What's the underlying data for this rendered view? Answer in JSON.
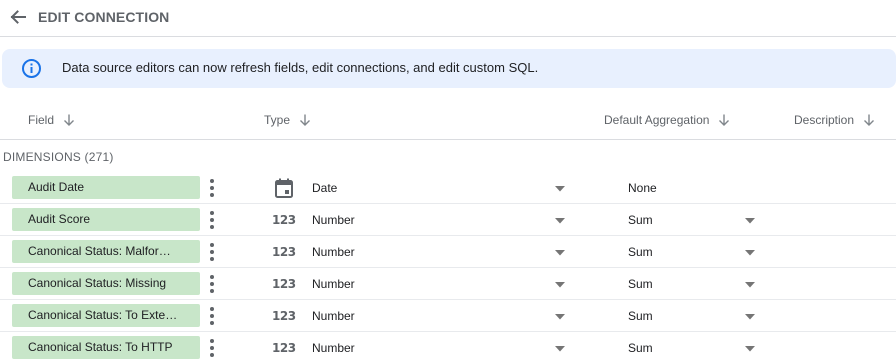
{
  "header": {
    "title": "EDIT CONNECTION"
  },
  "banner": {
    "text": "Data source editors can now refresh fields, edit connections, and edit custom SQL."
  },
  "columns": {
    "field": "Field",
    "type": "Type",
    "default_aggregation": "Default Aggregation",
    "description": "Description"
  },
  "dimensions": {
    "label": "DIMENSIONS (271)"
  },
  "rows": [
    {
      "field": "Audit Date",
      "type_icon": "calendar-icon",
      "type": "Date",
      "aggregation": "None",
      "aggregation_editable": false
    },
    {
      "field": "Audit Score",
      "type_icon": "number-icon",
      "type_icon_text": "123",
      "type": "Number",
      "aggregation": "Sum",
      "aggregation_editable": true
    },
    {
      "field": "Canonical Status: Malfor…",
      "type_icon": "number-icon",
      "type_icon_text": "123",
      "type": "Number",
      "aggregation": "Sum",
      "aggregation_editable": true
    },
    {
      "field": "Canonical Status: Missing",
      "type_icon": "number-icon",
      "type_icon_text": "123",
      "type": "Number",
      "aggregation": "Sum",
      "aggregation_editable": true
    },
    {
      "field": "Canonical Status: To Exte…",
      "type_icon": "number-icon",
      "type_icon_text": "123",
      "type": "Number",
      "aggregation": "Sum",
      "aggregation_editable": true
    },
    {
      "field": "Canonical Status: To HTTP",
      "type_icon": "number-icon",
      "type_icon_text": "123",
      "type": "Number",
      "aggregation": "Sum",
      "aggregation_editable": true
    }
  ],
  "colors": {
    "chip_background": "#c8e6c9",
    "banner_background": "#e8f0fe",
    "info_icon": "#1a73e8",
    "muted_text": "#5f6368"
  }
}
